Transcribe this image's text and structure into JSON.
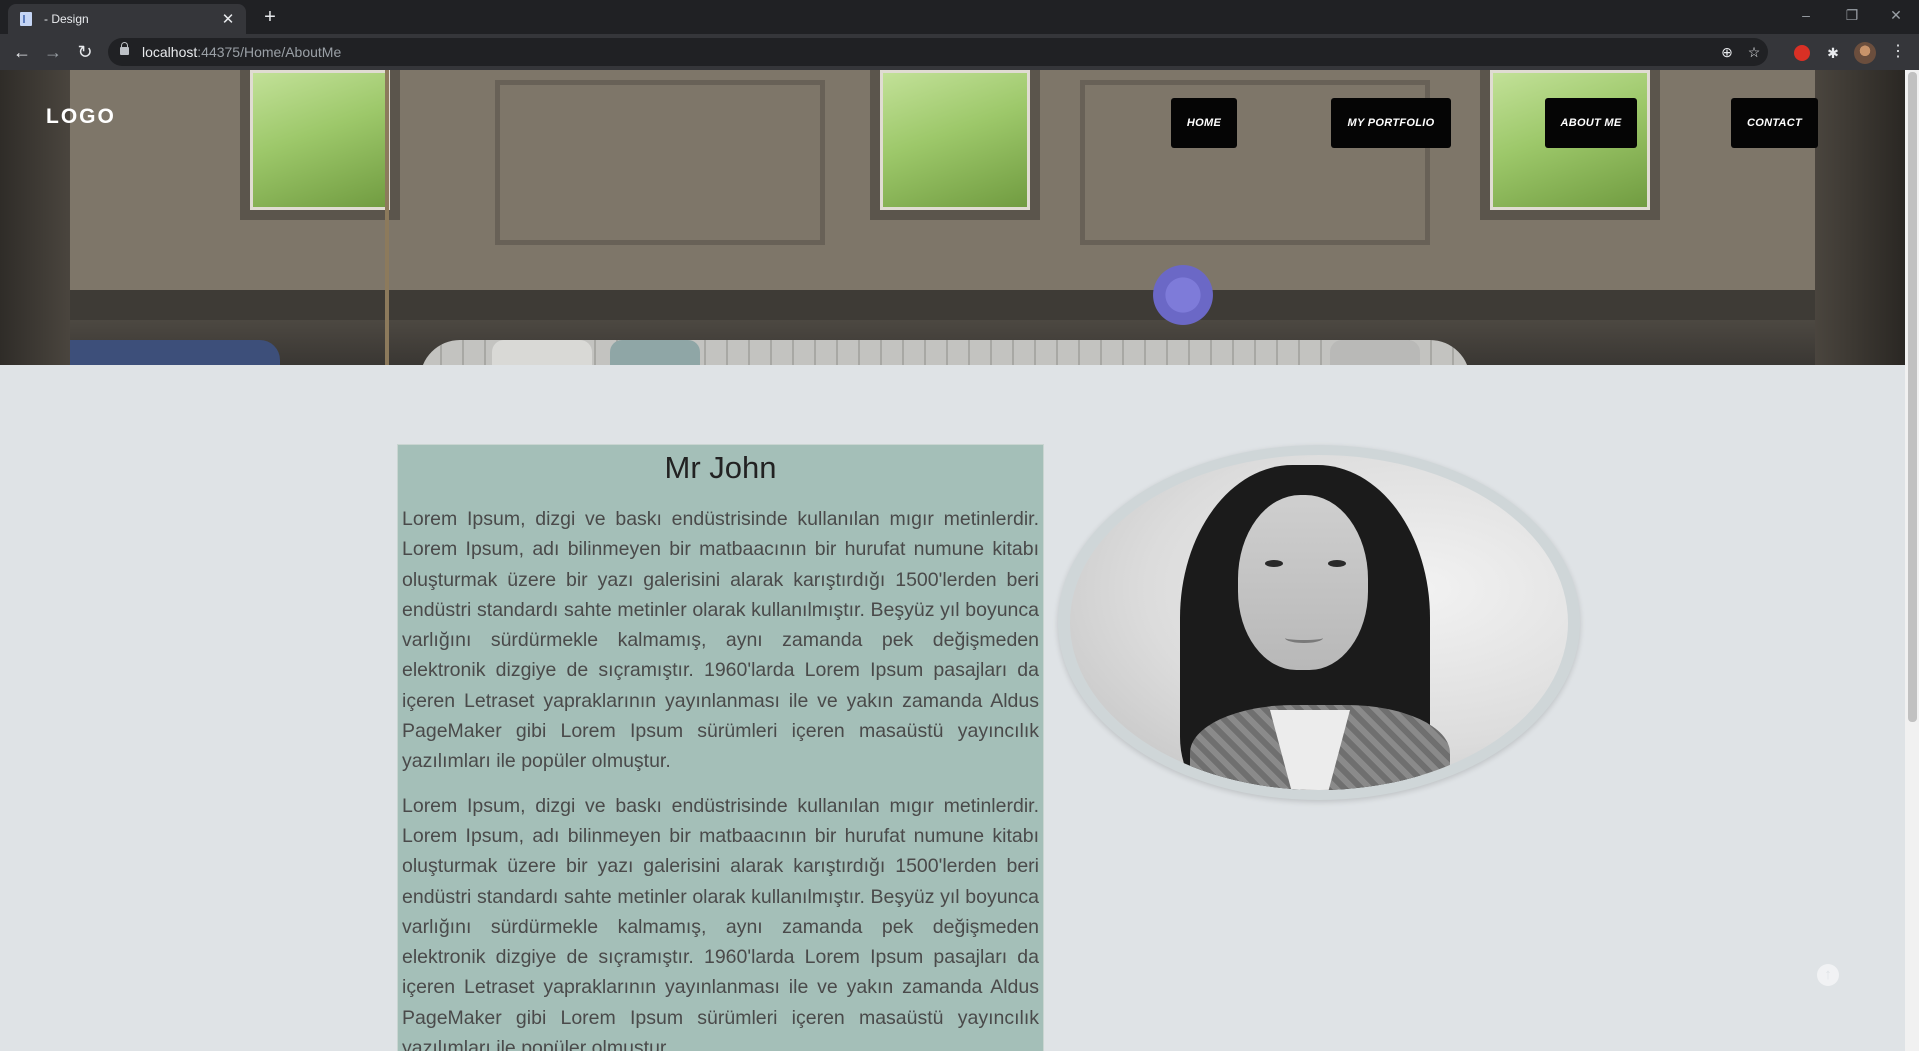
{
  "browser": {
    "tab_title": "- Design",
    "tab_close": "✕",
    "new_tab": "+",
    "url_host": "localhost",
    "url_path": ":44375/Home/AboutMe",
    "window_controls": [
      "–",
      "❐",
      "✕"
    ]
  },
  "site": {
    "logo": "LOGO",
    "nav": [
      {
        "label": "HOME"
      },
      {
        "label": "MY PORTFOLIO"
      },
      {
        "label": "ABOUT ME"
      },
      {
        "label": "CONTACT"
      }
    ]
  },
  "about": {
    "name": "Mr John",
    "paragraphs": [
      "Lorem Ipsum, dizgi ve baskı endüstrisinde kullanılan mıgır metinlerdir. Lorem Ipsum, adı bilinmeyen bir matbaacının bir hurufat numune kitabı oluşturmak üzere bir yazı galerisini alarak karıştırdığı 1500'lerden beri endüstri standardı sahte metinler olarak kullanılmıştır. Beşyüz yıl boyunca varlığını sürdürmekle kalmamış, aynı zamanda pek değişmeden elektronik dizgiye de sıçramıştır. 1960'larda Lorem Ipsum pasajları da içeren Letraset yapraklarının yayınlanması ile ve yakın zamanda Aldus PageMaker gibi Lorem Ipsum sürümleri içeren masaüstü yayıncılık yazılımları ile popüler olmuştur.",
      "Lorem Ipsum, dizgi ve baskı endüstrisinde kullanılan mıgır metinlerdir. Lorem Ipsum, adı bilinmeyen bir matbaacının bir hurufat numune kitabı oluşturmak üzere bir yazı galerisini alarak karıştırdığı 1500'lerden beri endüstri standardı sahte metinler olarak kullanılmıştır. Beşyüz yıl boyunca varlığını sürdürmekle kalmamış, aynı zamanda pek değişmeden elektronik dizgiye de sıçramıştır. 1960'larda Lorem Ipsum pasajları da içeren Letraset yapraklarının yayınlanması ile ve yakın zamanda Aldus PageMaker gibi Lorem Ipsum sürümleri içeren masaüstü yayıncılık yazılımları ile popüler olmuştur."
    ]
  },
  "colors": {
    "card_background": "#a4bfb8",
    "page_background": "#dfe3e6",
    "nav_button": "#050505"
  },
  "icons": {
    "back": "arrow-left-icon",
    "forward": "arrow-right-icon",
    "reload": "reload-icon",
    "zoom": "zoom-icon",
    "bookmark": "star-icon",
    "extensions": "puzzle-icon",
    "menu": "kebab-menu-icon",
    "scroll_top": "arrow-up-icon"
  }
}
